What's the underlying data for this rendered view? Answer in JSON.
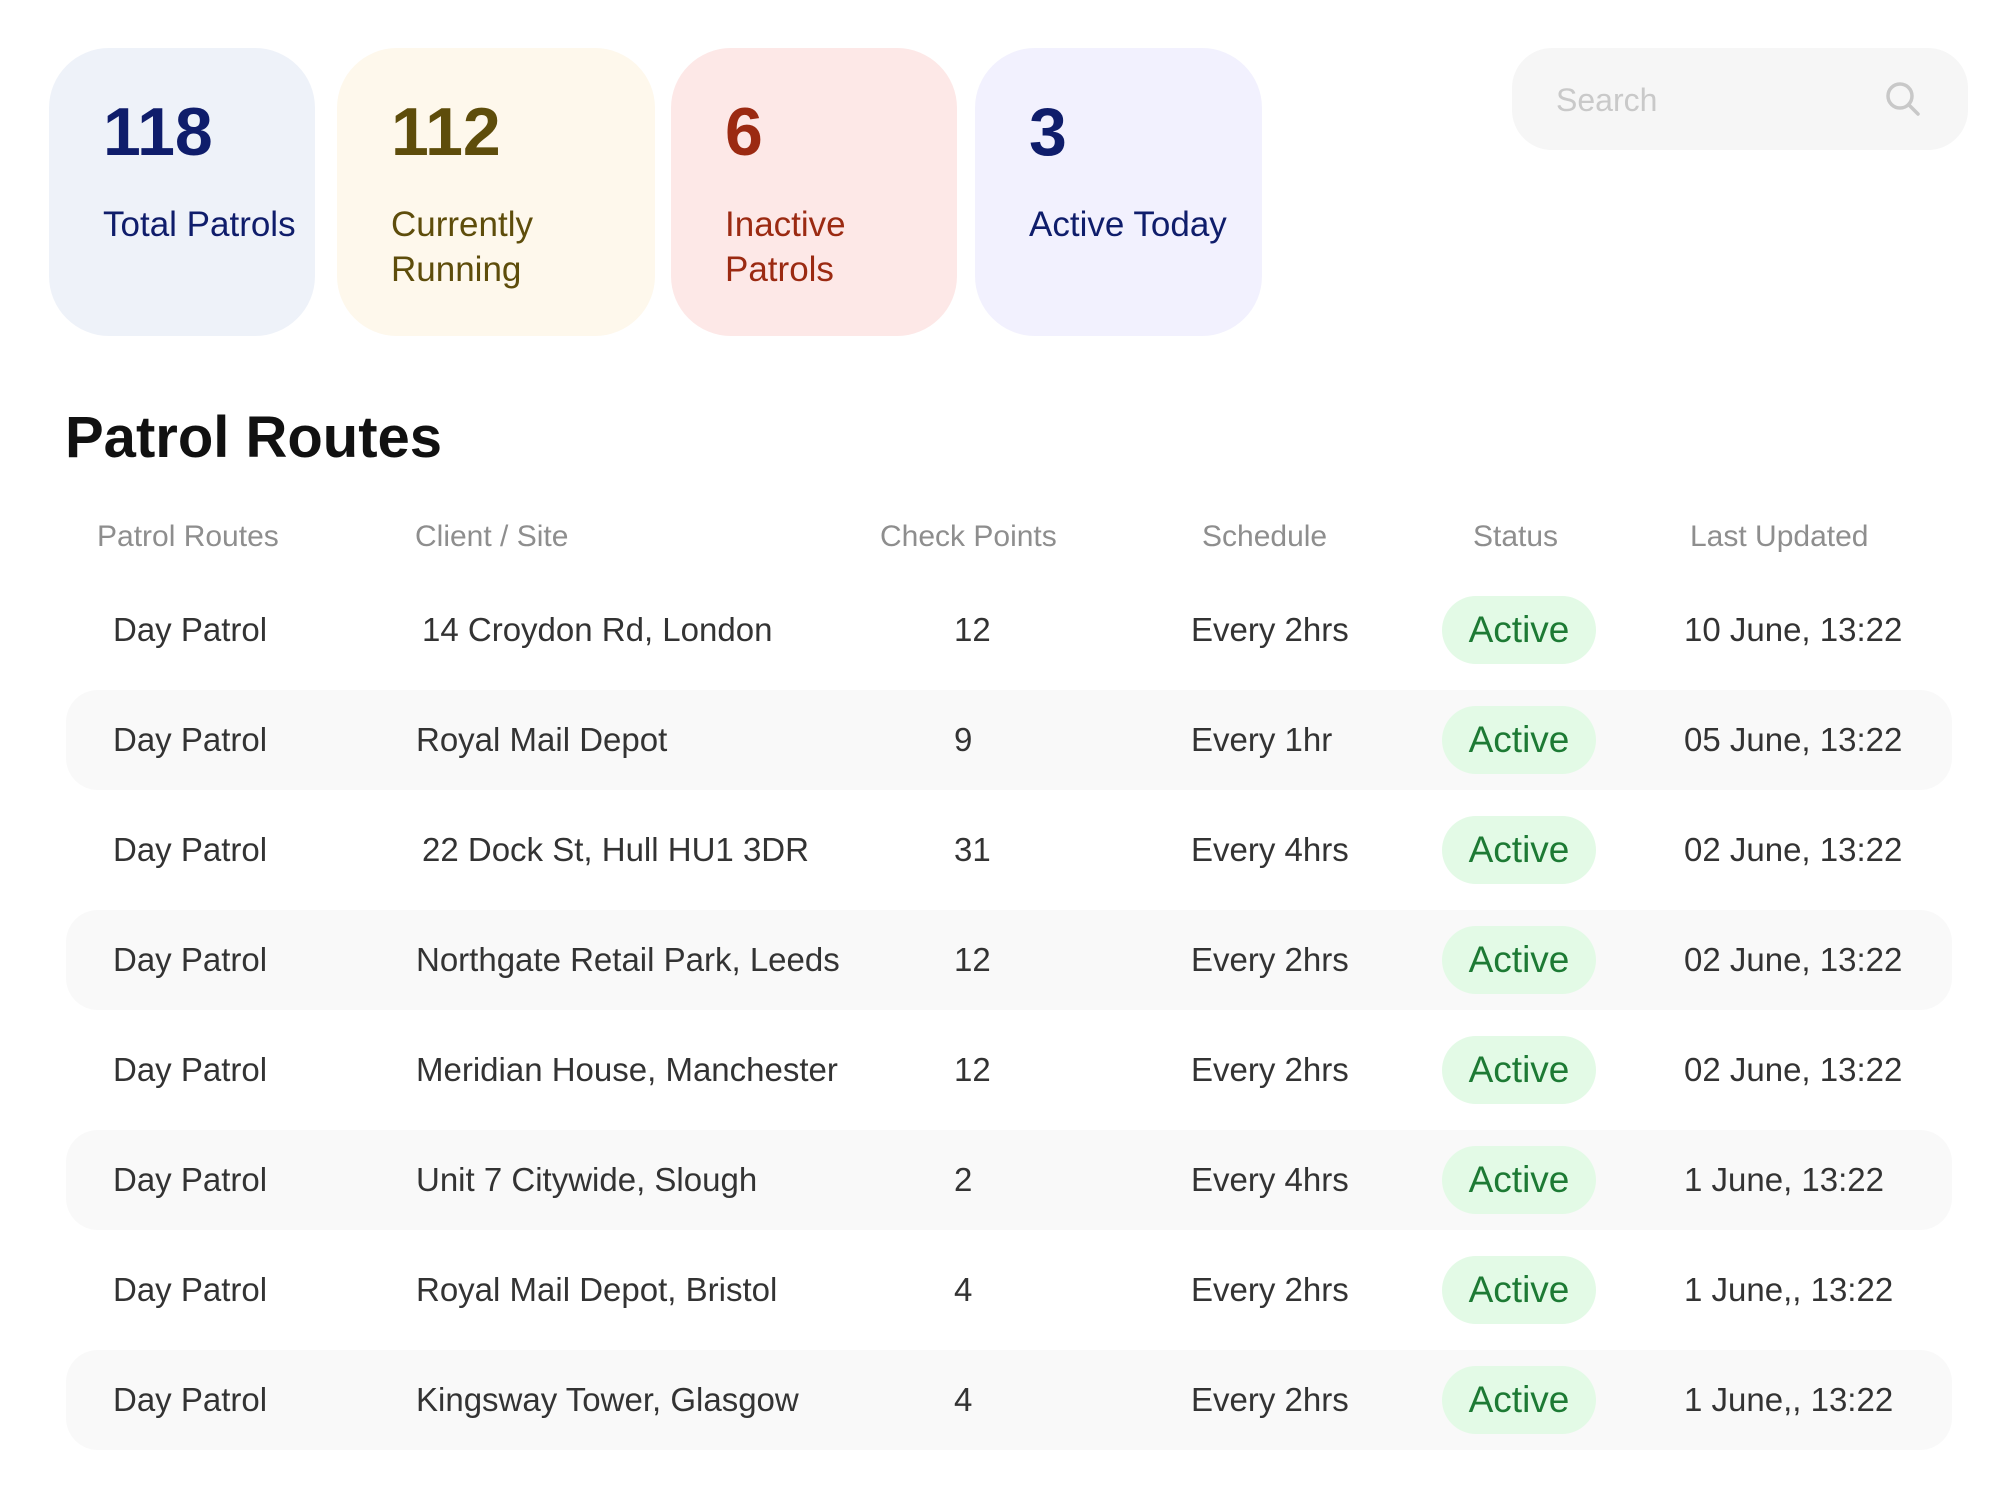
{
  "stats": [
    {
      "value": "118",
      "label": "Total Patrols"
    },
    {
      "value": "112",
      "label": "Currently Running"
    },
    {
      "value": "6",
      "label": "Inactive Patrols"
    },
    {
      "value": "3",
      "label": "Active Today"
    }
  ],
  "search": {
    "placeholder": "Search",
    "value": "",
    "icon": "search-icon"
  },
  "page_title": "Patrol Routes",
  "table": {
    "columns": [
      "Patrol Routes",
      "Client / Site",
      "Check Points",
      "Schedule",
      "Status",
      "Last Updated"
    ],
    "rows": [
      {
        "route": "Day Patrol",
        "client": "14 Croydon Rd, London",
        "checkpoints": "12",
        "schedule": "Every 2hrs",
        "status": "Active",
        "updated": "10 June, 13:22"
      },
      {
        "route": "Day Patrol",
        "client": "Royal Mail Depot",
        "checkpoints": "9",
        "schedule": "Every 1hr",
        "status": "Active",
        "updated": "05 June, 13:22"
      },
      {
        "route": "Day Patrol",
        "client": "22 Dock St, Hull HU1 3DR",
        "checkpoints": "31",
        "schedule": "Every 4hrs",
        "status": "Active",
        "updated": "02 June, 13:22"
      },
      {
        "route": "Day Patrol",
        "client": "Northgate Retail Park, Leeds",
        "checkpoints": "12",
        "schedule": "Every 2hrs",
        "status": "Active",
        "updated": "02 June, 13:22"
      },
      {
        "route": "Day Patrol",
        "client": "Meridian House, Manchester",
        "checkpoints": "12",
        "schedule": "Every 2hrs",
        "status": "Active",
        "updated": "02 June, 13:22"
      },
      {
        "route": "Day Patrol",
        "client": "Unit 7 Citywide, Slough",
        "checkpoints": "2",
        "schedule": "Every 4hrs",
        "status": "Active",
        "updated": "1 June, 13:22"
      },
      {
        "route": "Day Patrol",
        "client": "Royal Mail Depot, Bristol",
        "checkpoints": "4",
        "schedule": "Every 2hrs",
        "status": "Active",
        "updated": "1 June,, 13:22"
      },
      {
        "route": "Day Patrol",
        "client": "Kingsway Tower, Glasgow",
        "checkpoints": "4",
        "schedule": "Every 2hrs",
        "status": "Active",
        "updated": "1 June,, 13:22"
      }
    ]
  },
  "colors": {
    "status_active_bg": "#e3fae6",
    "status_active_text": "#1d7a34",
    "card_total_bg": "#eef2f9",
    "card_running_bg": "#fef8ec",
    "card_inactive_bg": "#fde8e7",
    "card_today_bg": "#f2f1fe"
  }
}
